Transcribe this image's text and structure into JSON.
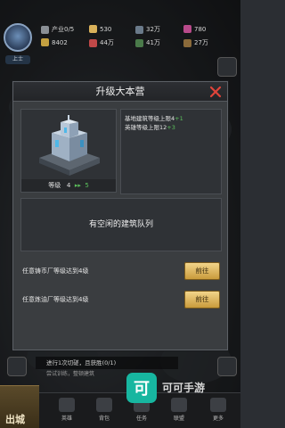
{
  "hud": {
    "level_label": "上士",
    "resources_row1": [
      "产业0/5",
      "530",
      "32万",
      "780"
    ],
    "resources_row2": [
      "8402",
      "44万",
      "41万",
      "27万"
    ]
  },
  "modal": {
    "title": "升级大本营",
    "level_label": "等级",
    "level_current": "4",
    "level_arrow": "▸▸",
    "level_next": "5",
    "effects": [
      {
        "text": "基地建筑等级上限4",
        "bonus": "+1"
      },
      {
        "text": "英雄等级上限12",
        "bonus": "+3"
      }
    ],
    "queue_text": "有空闲的建筑队列",
    "requirements": [
      {
        "text": "任意铸币厂等级达到4级",
        "button": "前往"
      },
      {
        "text": "任意炼油厂等级达到4级",
        "button": "前往"
      }
    ]
  },
  "bottom": {
    "city_label": "出城",
    "task_line1": "进行1次切磋，且获胜(0/1)",
    "task_line2": "尝试训练，整顿建筑",
    "nav": [
      "英雄",
      "背包",
      "任务",
      "联盟",
      "更多"
    ],
    "watermark": "可可手游"
  },
  "colors": {
    "accent_gold": "#d9b15a",
    "bonus_green": "#5cc25c",
    "close_red": "#e0443a"
  }
}
